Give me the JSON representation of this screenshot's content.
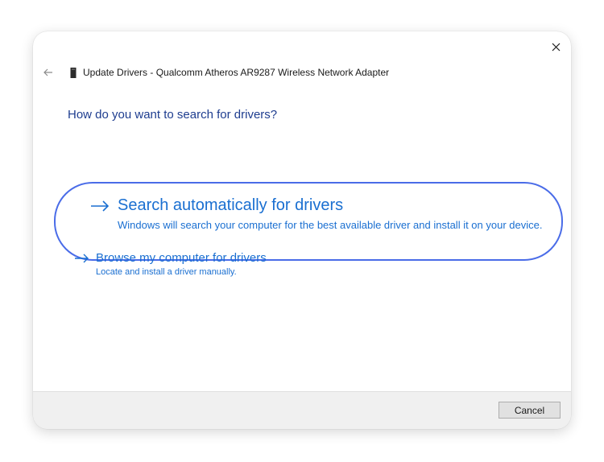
{
  "window": {
    "title": "Update Drivers - Qualcomm Atheros AR9287 Wireless Network Adapter",
    "close_icon": "close-icon",
    "back_icon": "back-arrow-icon",
    "device_icon": "network-adapter-icon"
  },
  "heading": "How do you want to search for drivers?",
  "options": {
    "automatic": {
      "title": "Search automatically for drivers",
      "description": "Windows will search your computer for the best available driver and install it on your device.",
      "icon": "arrow-right-icon",
      "highlighted": true
    },
    "browse": {
      "title": "Browse my computer for drivers",
      "description": "Locate and install a driver manually.",
      "icon": "arrow-right-icon"
    }
  },
  "footer": {
    "cancel_label": "Cancel"
  },
  "colors": {
    "link": "#1a6fd1",
    "heading": "#1e3d8f",
    "highlight_ring": "#4a6ce8",
    "footer_bg": "#f0f0f0"
  }
}
